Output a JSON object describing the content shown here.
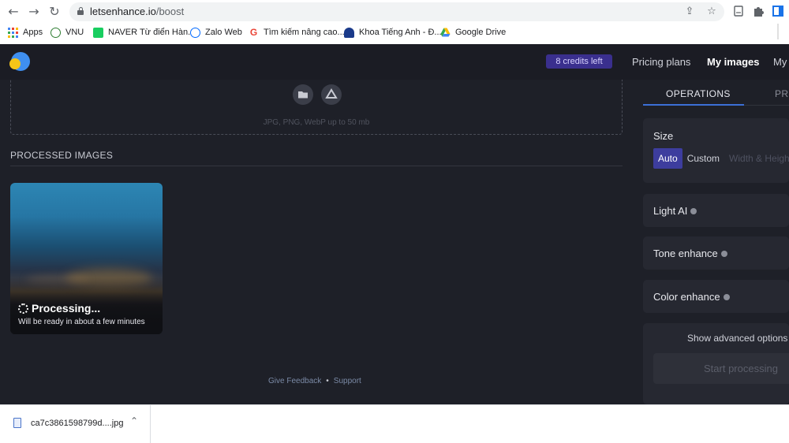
{
  "browser": {
    "url_host": "letsenhance.io",
    "url_path": "/boost",
    "icons": [
      "back-icon",
      "forward-icon",
      "reload-icon",
      "lock-icon",
      "share-icon",
      "star-icon",
      "extension-icon",
      "puzzle-icon",
      "profile-icon"
    ],
    "bookmarks": [
      {
        "label": "Apps",
        "icon": "apps-grid-icon",
        "color": "#4285f4"
      },
      {
        "label": "VNU",
        "icon": "vnu-icon",
        "color": "#2e7d32"
      },
      {
        "label": "NAVER Từ điển Hàn...",
        "icon": "naver-icon",
        "color": "#19ce60"
      },
      {
        "label": "Zalo Web",
        "icon": "zalo-icon",
        "color": "#0068ff"
      },
      {
        "label": "Tìm kiếm nâng cao...",
        "icon": "google-icon",
        "color": "#ea4335"
      },
      {
        "label": "Khoa Tiếng Anh - Đ...",
        "icon": "university-icon",
        "color": "#1a3a8a"
      },
      {
        "label": "Google Drive",
        "icon": "google-drive-icon",
        "color": "#fbbc04"
      }
    ]
  },
  "header": {
    "credits": "8 credits left",
    "nav": [
      "Pricing plans",
      "My images",
      "My"
    ]
  },
  "upload": {
    "hint": "JPG, PNG, WebP up to 50 mb",
    "icons": [
      "folder-icon",
      "google-drive-icon"
    ]
  },
  "processed": {
    "title": "PROCESSED IMAGES",
    "item": {
      "status": "Processing...",
      "note": "Will be ready in about a few minutes"
    }
  },
  "footer": {
    "feedback": "Give Feedback",
    "separator": "•",
    "support": "Support"
  },
  "panel": {
    "tabs": [
      "OPERATIONS",
      "PRE"
    ],
    "size": {
      "label": "Size",
      "options": [
        "Auto",
        "Custom",
        "Width & Heigh"
      ],
      "selected": "Auto"
    },
    "toggles": [
      "Light AI",
      "Tone enhance",
      "Color enhance"
    ],
    "advanced": "Show advanced options",
    "start": "Start processing"
  },
  "downloads": {
    "file": "ca7c3861598799d....jpg"
  },
  "colors": {
    "accent": "#3b6fd6",
    "credits_bg": "#3a2f8e",
    "selected_option": "#3d3d9e"
  }
}
